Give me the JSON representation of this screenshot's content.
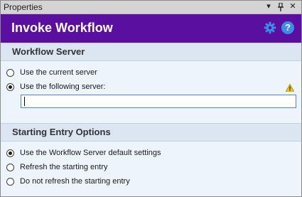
{
  "window": {
    "title": "Properties",
    "controls": {
      "dropdown": "▾",
      "pin": "ᛘ",
      "close": "✕"
    }
  },
  "header": {
    "title": "Invoke Workflow",
    "settings_icon": "gear-icon",
    "help_label": "?",
    "accent_color": "#5a0fa0"
  },
  "workflow_server": {
    "heading": "Workflow Server",
    "options": [
      {
        "label": "Use the current server",
        "checked": false
      },
      {
        "label": "Use the following server:",
        "checked": true
      }
    ],
    "server_input": {
      "value": "",
      "placeholder": ""
    },
    "warning_icon": "warning-icon"
  },
  "starting_entry": {
    "heading": "Starting Entry Options",
    "options": [
      {
        "label": "Use the Workflow Server default settings",
        "checked": true
      },
      {
        "label": "Refresh the starting entry",
        "checked": false
      },
      {
        "label": "Do not refresh the starting entry",
        "checked": false
      }
    ]
  }
}
